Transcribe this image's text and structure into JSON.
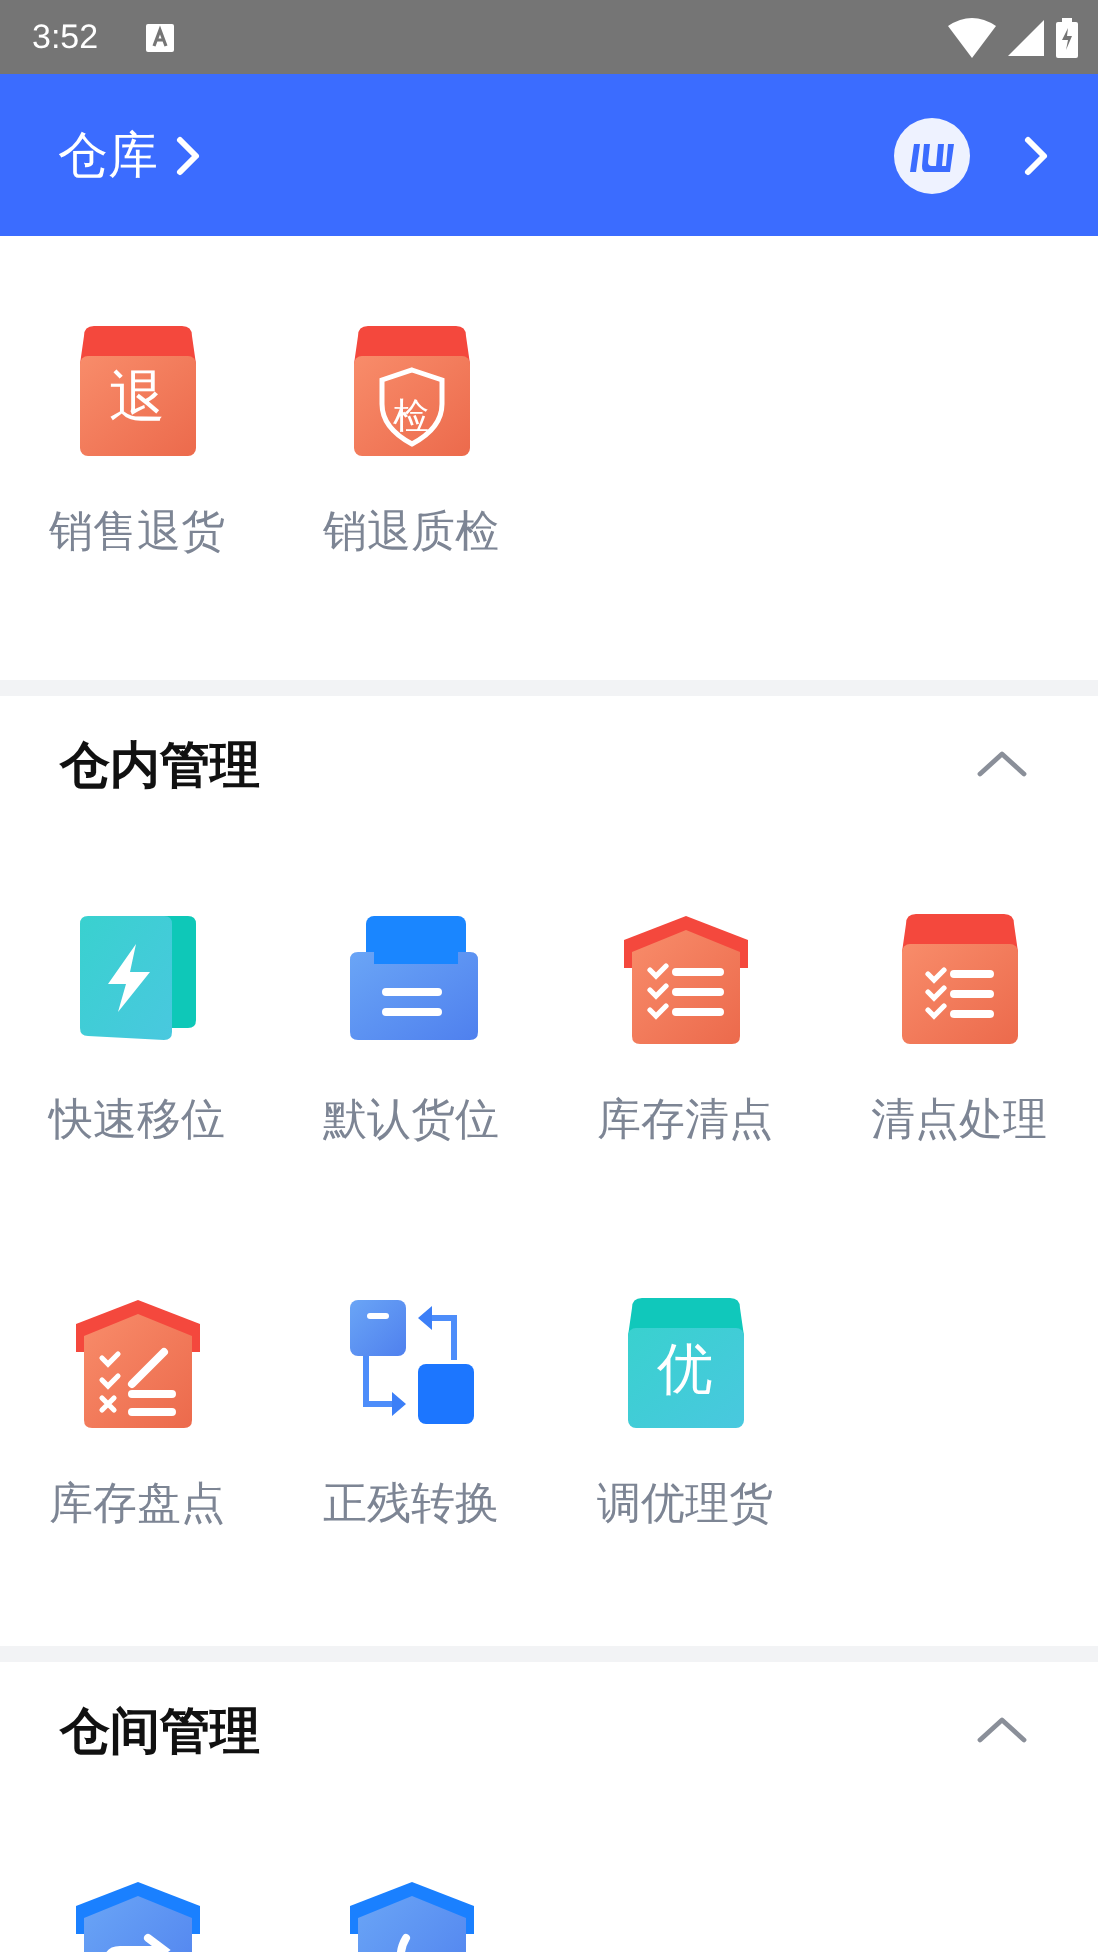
{
  "status_bar": {
    "time": "3:52"
  },
  "header": {
    "title": "仓库"
  },
  "sections": [
    {
      "items": [
        {
          "label": "销售退货",
          "kind": "box",
          "glyph": "退"
        },
        {
          "label": "销退质检",
          "kind": "shield",
          "glyph": "检"
        }
      ]
    },
    {
      "title": "仓内管理",
      "expanded": true,
      "items": [
        {
          "label": "快速移位",
          "kind": "bolt"
        },
        {
          "label": "默认货位",
          "kind": "tray"
        },
        {
          "label": "库存清点",
          "kind": "houselist"
        },
        {
          "label": "清点处理",
          "kind": "boxlist"
        },
        {
          "label": "库存盘点",
          "kind": "housecheck"
        },
        {
          "label": "正残转换",
          "kind": "transfer"
        },
        {
          "label": "调优理货",
          "kind": "tealbox",
          "glyph": "优"
        }
      ]
    },
    {
      "title": "仓间管理",
      "expanded": true,
      "items": [
        {
          "kind": "housearrow"
        },
        {
          "kind": "housephone"
        }
      ]
    }
  ]
}
